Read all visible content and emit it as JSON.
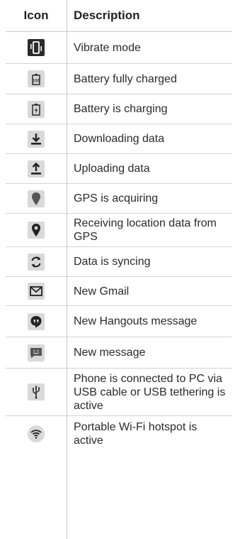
{
  "table": {
    "header": {
      "icon": "Icon",
      "description": "Description"
    },
    "rows": [
      {
        "icon": "vibrate-icon",
        "text": "Vibrate mode"
      },
      {
        "icon": "battery-full-icon",
        "text": "Battery fully charged"
      },
      {
        "icon": "battery-charging-icon",
        "text": "Battery is charging"
      },
      {
        "icon": "download-icon",
        "text": "Downloading data"
      },
      {
        "icon": "upload-icon",
        "text": "Uploading data"
      },
      {
        "icon": "gps-acquiring-icon",
        "text": "GPS is acquiring"
      },
      {
        "icon": "gps-location-icon",
        "text": "Receiving location data from GPS"
      },
      {
        "icon": "sync-icon",
        "text": "Data is syncing"
      },
      {
        "icon": "gmail-icon",
        "text": "New Gmail"
      },
      {
        "icon": "hangouts-icon",
        "text": "New Hangouts message"
      },
      {
        "icon": "message-icon",
        "text": "New message"
      },
      {
        "icon": "usb-icon",
        "text": "Phone is connected to PC via USB cable or USB tethering is active"
      },
      {
        "icon": "wifi-hotspot-icon",
        "text": "Portable Wi-Fi hotspot is active"
      }
    ]
  },
  "colors": {
    "icon_dark": "#2b2b2b",
    "icon_light": "#d9d9d9",
    "grid": "#c9c9c9",
    "text": "#2a2a2a"
  }
}
